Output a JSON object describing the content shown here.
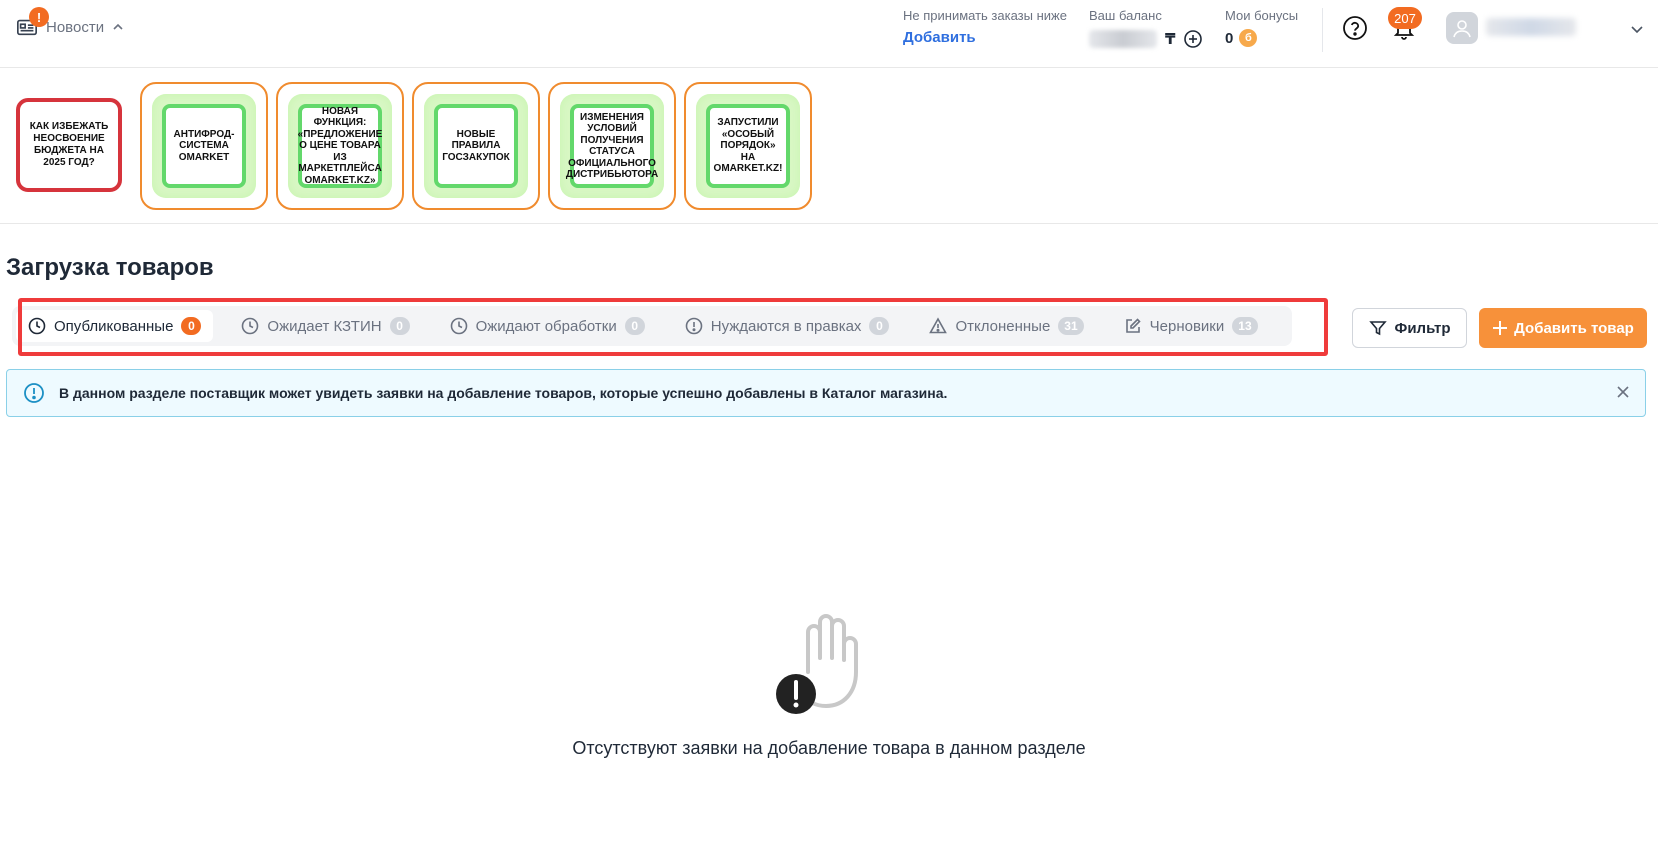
{
  "header": {
    "news_label": "Новости",
    "news_badge": "!",
    "min_order_caption": "Не принимать заказы ниже",
    "min_order_link": "Добавить",
    "balance_caption": "Ваш баланс",
    "balance_currency": "₸",
    "bonus_caption": "Мои бонусы",
    "bonus_value": "0",
    "bonus_coin": "б",
    "notifications_count": "207"
  },
  "stories": [
    {
      "text": "КАК ИЗБЕЖАТЬ НЕОСВОЕНИЕ БЮДЖЕТА НА 2025 ГОД?"
    },
    {
      "text": "АНТИФРОД-СИСТЕМА OMARKET"
    },
    {
      "text": "НОВАЯ ФУНКЦИЯ: «ПРЕДЛОЖЕНИЕ О ЦЕНЕ ТОВАРА ИЗ МАРКЕТПЛЕЙСА OMARKET.KZ»"
    },
    {
      "text": "НОВЫЕ ПРАВИЛА ГОСЗАКУПОК"
    },
    {
      "text": "ИЗМЕНЕНИЯ УСЛОВИЙ ПОЛУЧЕНИЯ СТАТУСА ОФИЦИАЛЬНОГО ДИСТРИБЬЮТОРА"
    },
    {
      "text": "ЗАПУСТИЛИ «ОСОБЫЙ ПОРЯДОК» НА OMARKET.KZ!"
    }
  ],
  "page": {
    "title": "Загрузка товаров"
  },
  "tabs": [
    {
      "label": "Опубликованные",
      "count": "0",
      "icon": "clock-icon",
      "active": true
    },
    {
      "label": "Ожидает КЗТИН",
      "count": "0",
      "icon": "clock-icon",
      "active": false
    },
    {
      "label": "Ожидают обработки",
      "count": "0",
      "icon": "clock-icon",
      "active": false
    },
    {
      "label": "Нуждаются в правках",
      "count": "0",
      "icon": "exclamation-circle-icon",
      "active": false
    },
    {
      "label": "Отклоненные",
      "count": "31",
      "icon": "warning-triangle-icon",
      "active": false
    },
    {
      "label": "Черновики",
      "count": "13",
      "icon": "edit-icon",
      "active": false
    }
  ],
  "toolbar": {
    "filter_label": "Фильтр",
    "add_label": "Добавить товар"
  },
  "alert": {
    "text": "В данном разделе поставщик может увидеть заявки на добавление товаров, которые успешно добавлены в Каталог магазина."
  },
  "empty": {
    "text": "Отсутствуют заявки на добавление товара в данном разделе"
  },
  "colors": {
    "accent": "#f26b21",
    "primary_button": "#f7913a",
    "link": "#2f6fdf",
    "highlight_border": "#ef3b3b",
    "story_border": "#f08b2e",
    "story_card_border": "#63d86b"
  }
}
